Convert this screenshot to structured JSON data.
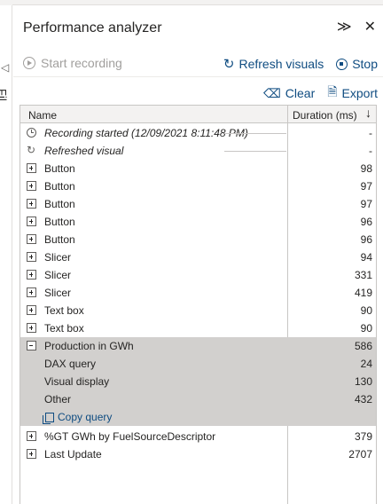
{
  "left_strip": {
    "vertical_text": "Fil"
  },
  "panel": {
    "title": "Performance analyzer",
    "start_recording": "Start recording",
    "refresh_visuals": "Refresh visuals",
    "stop": "Stop",
    "clear": "Clear",
    "export": "Export"
  },
  "table": {
    "col_name": "Name",
    "col_duration": "Duration (ms)",
    "rows": [
      {
        "name": "Recording started (12/09/2021 8:11:48 PM)",
        "duration": "-"
      },
      {
        "name": "Refreshed visual",
        "duration": "-"
      },
      {
        "name": "Button",
        "duration": "98"
      },
      {
        "name": "Button",
        "duration": "97"
      },
      {
        "name": "Button",
        "duration": "97"
      },
      {
        "name": "Button",
        "duration": "96"
      },
      {
        "name": "Button",
        "duration": "96"
      },
      {
        "name": "Slicer",
        "duration": "94"
      },
      {
        "name": "Slicer",
        "duration": "331"
      },
      {
        "name": "Slicer",
        "duration": "419"
      },
      {
        "name": "Text box",
        "duration": "90"
      },
      {
        "name": "Text box",
        "duration": "90"
      },
      {
        "name": "Production in GWh",
        "duration": "586"
      },
      {
        "name": "DAX query",
        "duration": "24"
      },
      {
        "name": "Visual display",
        "duration": "130"
      },
      {
        "name": "Other",
        "duration": "432"
      },
      {
        "name": "Copy query",
        "duration": ""
      },
      {
        "name": "%GT GWh by FuelSourceDescriptor",
        "duration": "379"
      },
      {
        "name": "Last Update",
        "duration": "2707"
      }
    ]
  },
  "colors": {
    "accent": "#0f4c81",
    "selected_bg": "#d2d0ce",
    "header_bg": "#f3f2f1"
  }
}
